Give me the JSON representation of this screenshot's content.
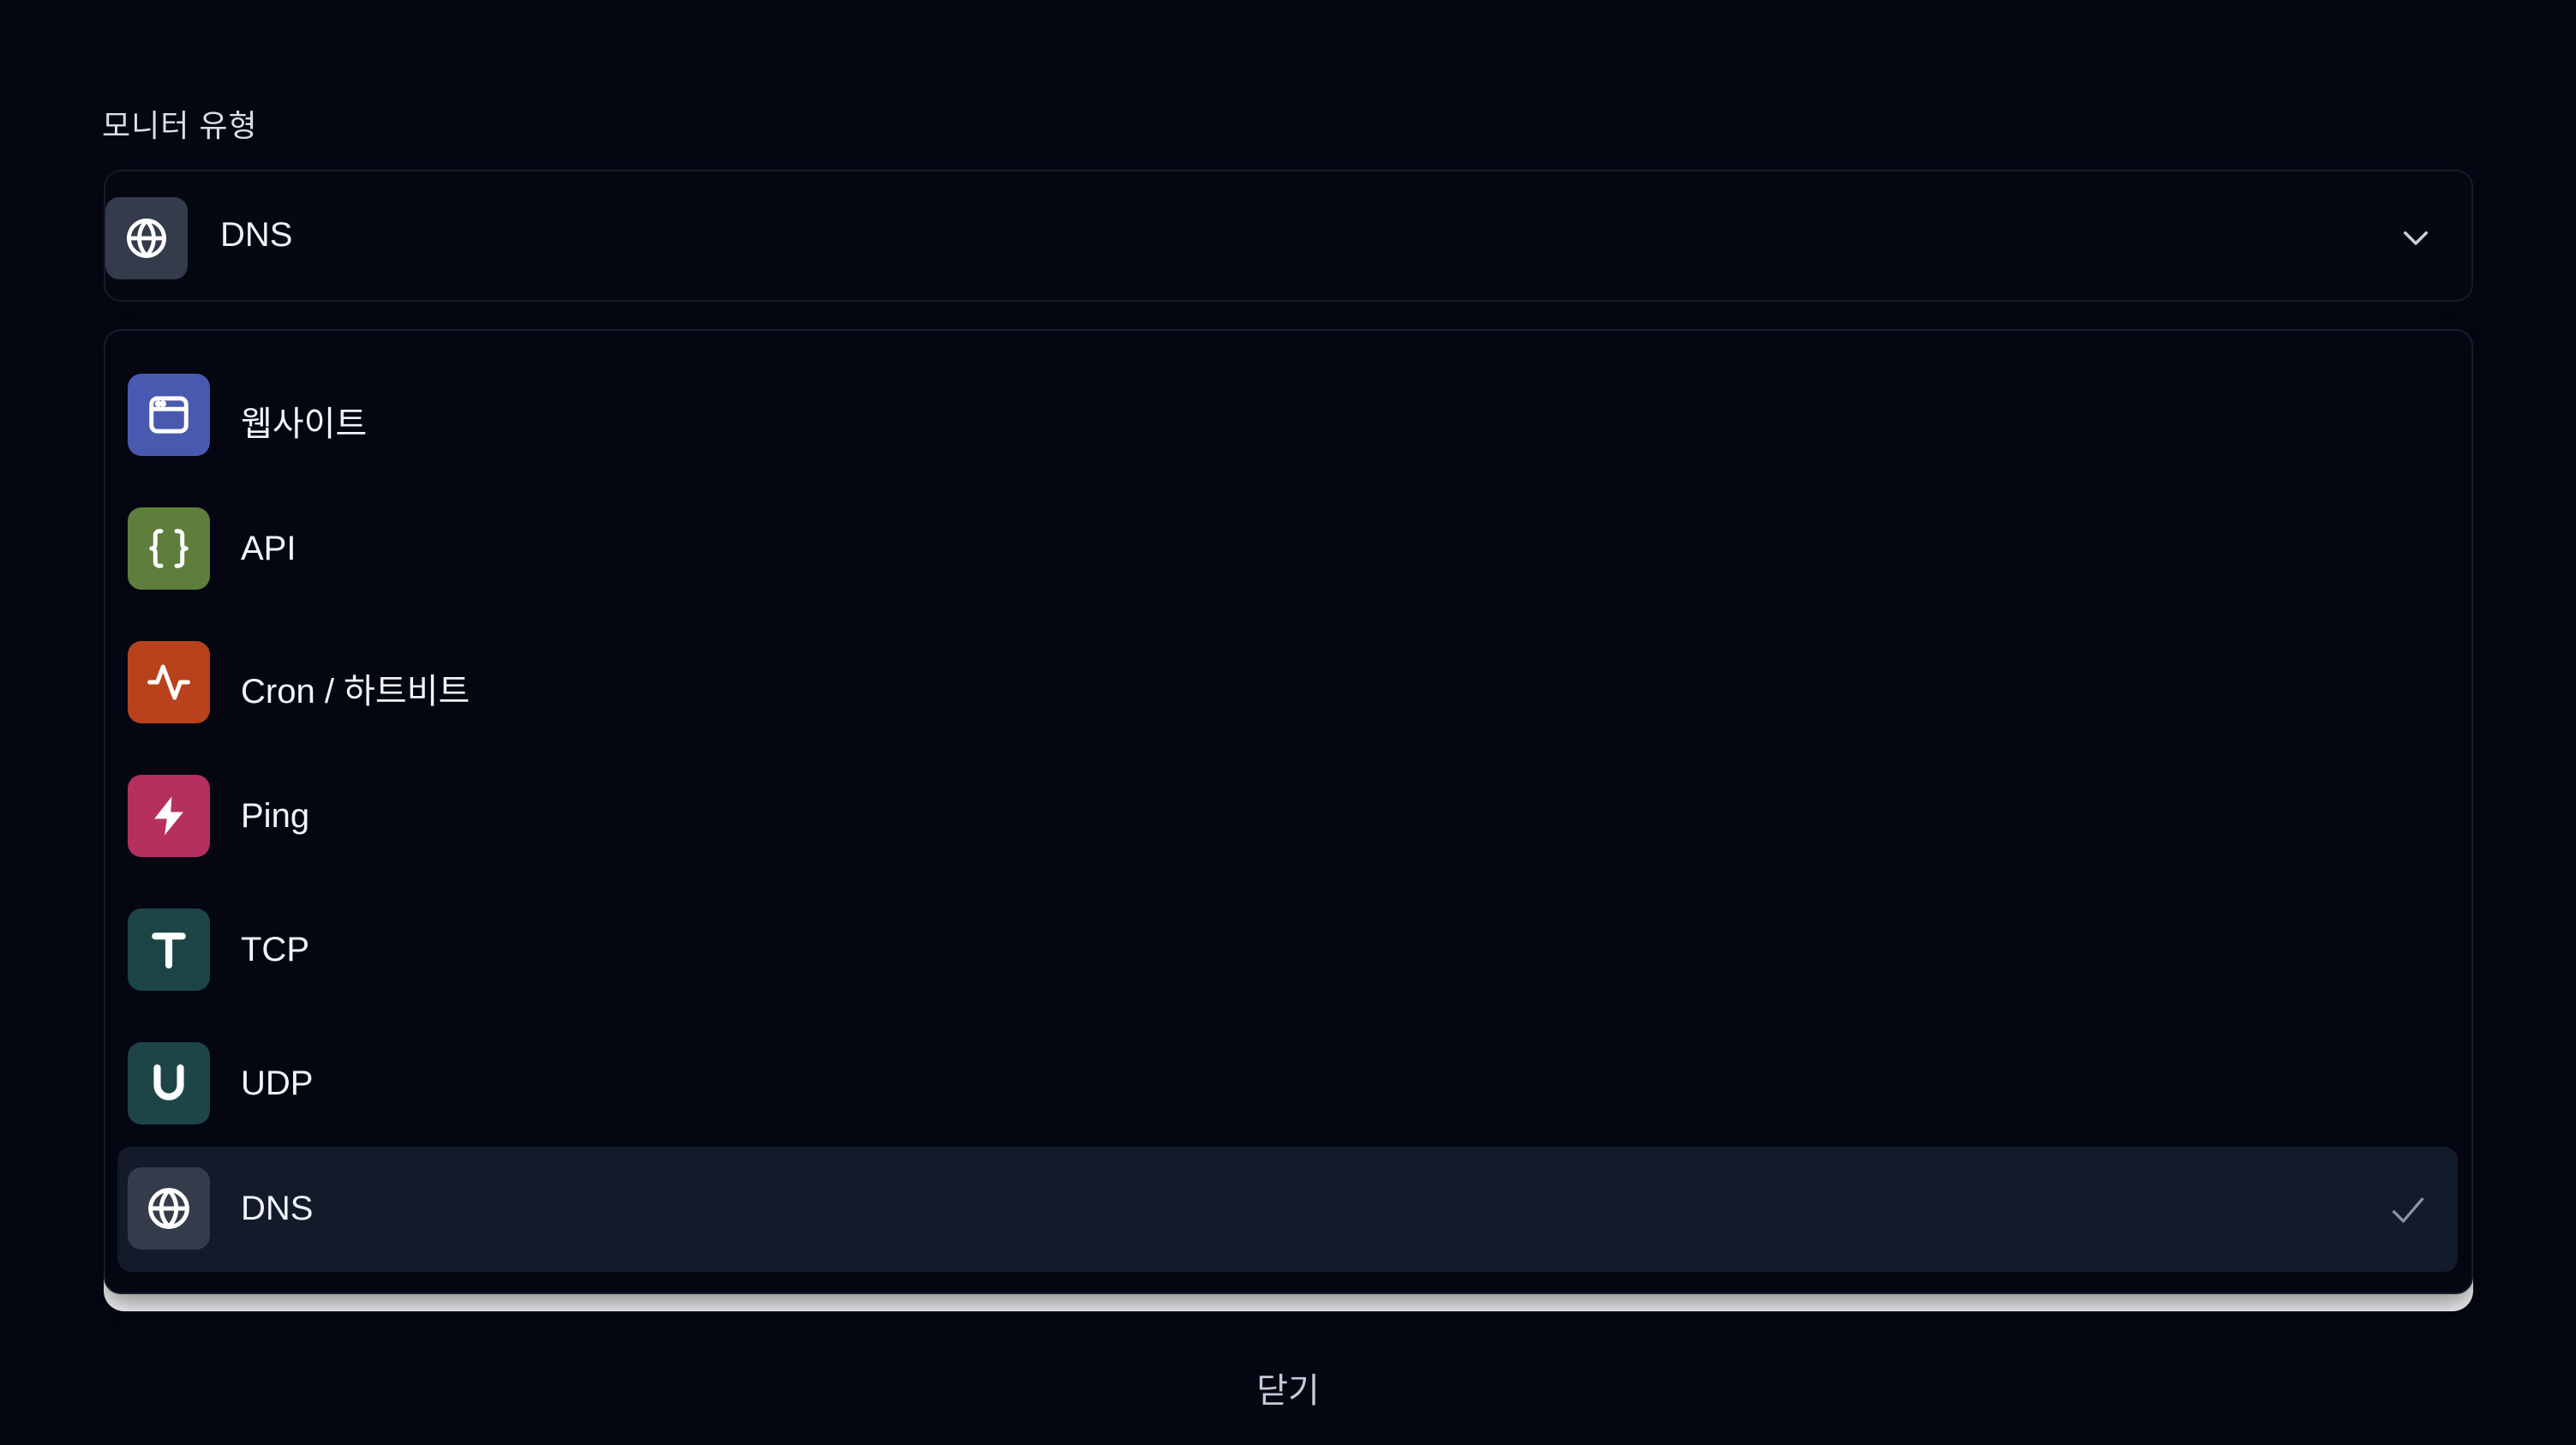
{
  "field": {
    "label": "모니터 유형"
  },
  "select": {
    "value": "DNS",
    "icon": "globe-icon",
    "icon_bg": "#343b4b"
  },
  "options": [
    {
      "label": "웹사이트",
      "icon": "browser-window-icon",
      "color": "#4a59b0"
    },
    {
      "label": "API",
      "icon": "curly-braces-icon",
      "color": "#5e7f3b"
    },
    {
      "label": "Cron / 하트비트",
      "icon": "activity-pulse-icon",
      "color": "#b8421c"
    },
    {
      "label": "Ping",
      "icon": "lightning-bolt-icon",
      "color": "#b5305f"
    },
    {
      "label": "TCP",
      "icon": "letter-t-icon",
      "color": "#1e4546"
    },
    {
      "label": "UDP",
      "icon": "letter-u-icon",
      "color": "#1e4546"
    },
    {
      "label": "DNS",
      "icon": "globe-icon",
      "color": "#343b4b",
      "selected": true
    }
  ],
  "footer": {
    "close_label": "닫기"
  },
  "colors": {
    "background": "#040712",
    "selected_row": "#131a2a",
    "border": "#161c2b"
  }
}
